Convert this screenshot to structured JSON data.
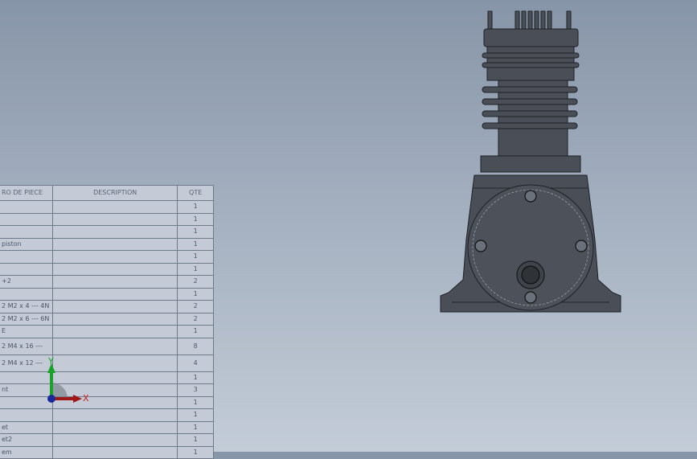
{
  "bom": {
    "headers": {
      "item": "RO DE PIECE",
      "description": "DESCRIPTION",
      "qty": "QTE"
    },
    "rows": [
      {
        "item": "",
        "description": "",
        "qty": "1"
      },
      {
        "item": "",
        "description": "",
        "qty": "1"
      },
      {
        "item": "",
        "description": "",
        "qty": "1"
      },
      {
        "item": "piston",
        "description": "",
        "qty": "1"
      },
      {
        "item": "",
        "description": "",
        "qty": "1"
      },
      {
        "item": "",
        "description": "",
        "qty": "1"
      },
      {
        "item": "+2",
        "description": "",
        "qty": "2"
      },
      {
        "item": "",
        "description": "",
        "qty": "1"
      },
      {
        "item": "2 M2 x 4 --- 4N",
        "description": "",
        "qty": "2"
      },
      {
        "item": "2 M2 x 6 --- 6N",
        "description": "",
        "qty": "2"
      },
      {
        "item": "E",
        "description": "",
        "qty": "1"
      },
      {
        "item": "2 M4 x 16 ---",
        "description": "",
        "qty": "8"
      },
      {
        "item": "2 M4 x 12 ---",
        "description": "",
        "qty": "4"
      },
      {
        "item": "",
        "description": "",
        "qty": "1"
      },
      {
        "item": "nt",
        "description": "",
        "qty": "3"
      },
      {
        "item": "",
        "description": "",
        "qty": "1"
      },
      {
        "item": "",
        "description": "",
        "qty": "1"
      },
      {
        "item": "et",
        "description": "",
        "qty": "1"
      },
      {
        "item": "et2",
        "description": "",
        "qty": "1"
      },
      {
        "item": "em",
        "description": "",
        "qty": "1"
      }
    ]
  },
  "triad": {
    "y_label": "Y",
    "x_label": "X"
  },
  "colors": {
    "body": "#4a4f57",
    "edge": "#1e2126",
    "highlight": "#6b717a"
  }
}
